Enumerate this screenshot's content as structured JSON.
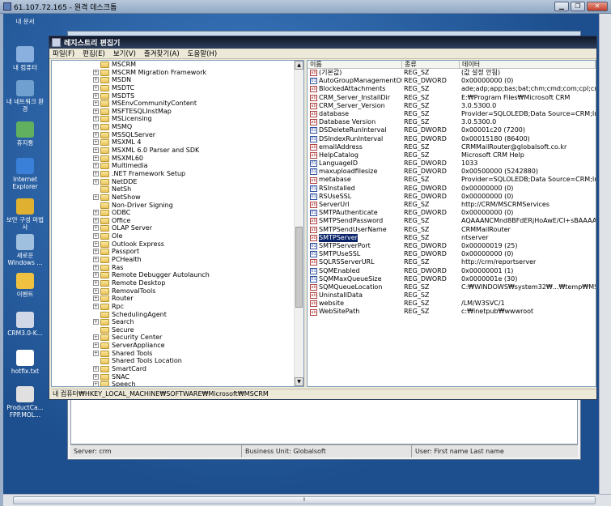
{
  "remote": {
    "title": "61.107.72.165 - 원격 데스크톱"
  },
  "desktop": {
    "icons": [
      {
        "label": "내 문서"
      },
      {
        "label": "내 컴퓨터"
      },
      {
        "label": "내 네트워크 환경"
      },
      {
        "label": "휴지통"
      },
      {
        "label": "Internet Explorer"
      },
      {
        "label": "보안 구성 마법사"
      },
      {
        "label": "새로운 Windows ..."
      },
      {
        "label": "이벤트"
      },
      {
        "label": "CRM3.0-K..."
      },
      {
        "label": "hotfix.txt"
      },
      {
        "label": "ProductCa... FPP.MOL..."
      }
    ]
  },
  "crm": {
    "status": {
      "server": "Server: crm",
      "business_unit": "Business Unit: Globalsoft",
      "user": "User: First name Last name"
    }
  },
  "regedit": {
    "title": "레지스트리 편집기",
    "menu": [
      "파일(F)",
      "편집(E)",
      "보기(V)",
      "즐겨찾기(A)",
      "도움말(H)"
    ],
    "tree": [
      {
        "label": "MSCRM",
        "exp": ""
      },
      {
        "label": "MSCRM Migration Framework",
        "exp": "+"
      },
      {
        "label": "MSDN",
        "exp": "+"
      },
      {
        "label": "MSDTC",
        "exp": "+"
      },
      {
        "label": "MSDTS",
        "exp": "+"
      },
      {
        "label": "MSEnvCommunityContent",
        "exp": "+"
      },
      {
        "label": "MSFTESQLInstMap",
        "exp": "+"
      },
      {
        "label": "MSLicensing",
        "exp": "+"
      },
      {
        "label": "MSMQ",
        "exp": "+"
      },
      {
        "label": "MSSQLServer",
        "exp": "+"
      },
      {
        "label": "MSXML 4",
        "exp": "+"
      },
      {
        "label": "MSXML 6.0 Parser and SDK",
        "exp": "+"
      },
      {
        "label": "MSXML60",
        "exp": "+"
      },
      {
        "label": "Multimedia",
        "exp": "+"
      },
      {
        "label": ".NET Framework Setup",
        "exp": "+"
      },
      {
        "label": "NetDDE",
        "exp": "+"
      },
      {
        "label": "NetSh",
        "exp": ""
      },
      {
        "label": "NetShow",
        "exp": "+"
      },
      {
        "label": "Non-Driver Signing",
        "exp": ""
      },
      {
        "label": "ODBC",
        "exp": "+"
      },
      {
        "label": "Office",
        "exp": "+"
      },
      {
        "label": "OLAP Server",
        "exp": "+"
      },
      {
        "label": "Ole",
        "exp": "+"
      },
      {
        "label": "Outlook Express",
        "exp": "+"
      },
      {
        "label": "Passport",
        "exp": "+"
      },
      {
        "label": "PCHealth",
        "exp": "+"
      },
      {
        "label": "Ras",
        "exp": "+"
      },
      {
        "label": "Remote Debugger Autolaunch",
        "exp": "+"
      },
      {
        "label": "Remote Desktop",
        "exp": "+"
      },
      {
        "label": "RemovalTools",
        "exp": "+"
      },
      {
        "label": "Router",
        "exp": "+"
      },
      {
        "label": "Rpc",
        "exp": "+"
      },
      {
        "label": "SchedulingAgent",
        "exp": ""
      },
      {
        "label": "Search",
        "exp": "+"
      },
      {
        "label": "Secure",
        "exp": ""
      },
      {
        "label": "Security Center",
        "exp": "+"
      },
      {
        "label": "ServerAppliance",
        "exp": "+"
      },
      {
        "label": "Shared Tools",
        "exp": "+"
      },
      {
        "label": "Shared Tools Location",
        "exp": ""
      },
      {
        "label": "SmartCard",
        "exp": "+"
      },
      {
        "label": "SNAC",
        "exp": "+"
      },
      {
        "label": "Speech",
        "exp": "+"
      }
    ],
    "columns": [
      "이름",
      "종류",
      "데이터"
    ],
    "values": [
      {
        "name": "(기본값)",
        "type": "REG_SZ",
        "data": "(값 설정 안됨)",
        "kind": "sz"
      },
      {
        "name": "AutoGroupManagementOff",
        "type": "REG_DWORD",
        "data": "0x00000000 (0)",
        "kind": "dw"
      },
      {
        "name": "BlockedAttachments",
        "type": "REG_SZ",
        "data": "ade;adp;app;bas;bat;chm;cmd;com;cpl;crt;cs...",
        "kind": "sz"
      },
      {
        "name": "CRM_Server_InstallDir",
        "type": "REG_SZ",
        "data": "E:₩Program Files₩Microsoft CRM",
        "kind": "sz"
      },
      {
        "name": "CRM_Server_Version",
        "type": "REG_SZ",
        "data": "3.0.5300.0",
        "kind": "sz"
      },
      {
        "name": "database",
        "type": "REG_SZ",
        "data": "Provider=SQLOLEDB;Data Source=CRM;Initial ...",
        "kind": "sz"
      },
      {
        "name": "Database Version",
        "type": "REG_SZ",
        "data": "3.0.5300.0",
        "kind": "sz"
      },
      {
        "name": "DSDeleteRunInterval",
        "type": "REG_DWORD",
        "data": "0x00001c20 (7200)",
        "kind": "dw"
      },
      {
        "name": "DSIndexRunInterval",
        "type": "REG_DWORD",
        "data": "0x00015180 (86400)",
        "kind": "dw"
      },
      {
        "name": "emailAddress",
        "type": "REG_SZ",
        "data": "CRMMailRouter@globalsoft.co.kr",
        "kind": "sz"
      },
      {
        "name": "HelpCatalog",
        "type": "REG_SZ",
        "data": "Microsoft CRM Help",
        "kind": "sz"
      },
      {
        "name": "LanguageID",
        "type": "REG_DWORD",
        "data": "1033",
        "kind": "dw"
      },
      {
        "name": "maxuploadfilesize",
        "type": "REG_DWORD",
        "data": "0x00500000 (5242880)",
        "kind": "dw"
      },
      {
        "name": "metabase",
        "type": "REG_SZ",
        "data": "Provider=SQLOLEDB;Data Source=CRM;Initial ...",
        "kind": "sz"
      },
      {
        "name": "RSInstalled",
        "type": "REG_DWORD",
        "data": "0x00000000 (0)",
        "kind": "dw"
      },
      {
        "name": "RSUseSSL",
        "type": "REG_DWORD",
        "data": "0x00000000 (0)",
        "kind": "dw"
      },
      {
        "name": "ServerUrl",
        "type": "REG_SZ",
        "data": "http://CRM/MSCRMServices",
        "kind": "sz"
      },
      {
        "name": "SMTPAuthenticate",
        "type": "REG_DWORD",
        "data": "0x00000000 (0)",
        "kind": "dw"
      },
      {
        "name": "SMTPSendPassword",
        "type": "REG_SZ",
        "data": "AQAAANCMnd8BFdERjHoAwE/Cl+sBAAAAZa1...",
        "kind": "sz"
      },
      {
        "name": "SMTPSendUserName",
        "type": "REG_SZ",
        "data": "CRMMailRouter",
        "kind": "sz"
      },
      {
        "name": "SMTPServer",
        "type": "REG_SZ",
        "data": "ntserver",
        "kind": "sz",
        "selected": true
      },
      {
        "name": "SMTPServerPort",
        "type": "REG_DWORD",
        "data": "0x00000019 (25)",
        "kind": "dw"
      },
      {
        "name": "SMTPUseSSL",
        "type": "REG_DWORD",
        "data": "0x00000000 (0)",
        "kind": "dw"
      },
      {
        "name": "SQLRSServerURL",
        "type": "REG_SZ",
        "data": "http://crm/reportserver",
        "kind": "sz"
      },
      {
        "name": "SQMEnabled",
        "type": "REG_DWORD",
        "data": "0x00000001 (1)",
        "kind": "dw"
      },
      {
        "name": "SQMMaxQueueSize",
        "type": "REG_DWORD",
        "data": "0x0000001e (30)",
        "kind": "dw"
      },
      {
        "name": "SQMQueueLocation",
        "type": "REG_SZ",
        "data": "C:₩WINDOWS₩system32₩...₩temp₩MSCRM...",
        "kind": "sz"
      },
      {
        "name": "UninstallData",
        "type": "REG_SZ",
        "data": "",
        "kind": "sz"
      },
      {
        "name": "website",
        "type": "REG_SZ",
        "data": "/LM/W3SVC/1",
        "kind": "sz"
      },
      {
        "name": "WebSitePath",
        "type": "REG_SZ",
        "data": "c:₩inetpub₩wwwroot",
        "kind": "sz"
      }
    ],
    "statusbar": "내 컴퓨터₩HKEY_LOCAL_MACHINE₩SOFTWARE₩Microsoft₩MSCRM"
  }
}
